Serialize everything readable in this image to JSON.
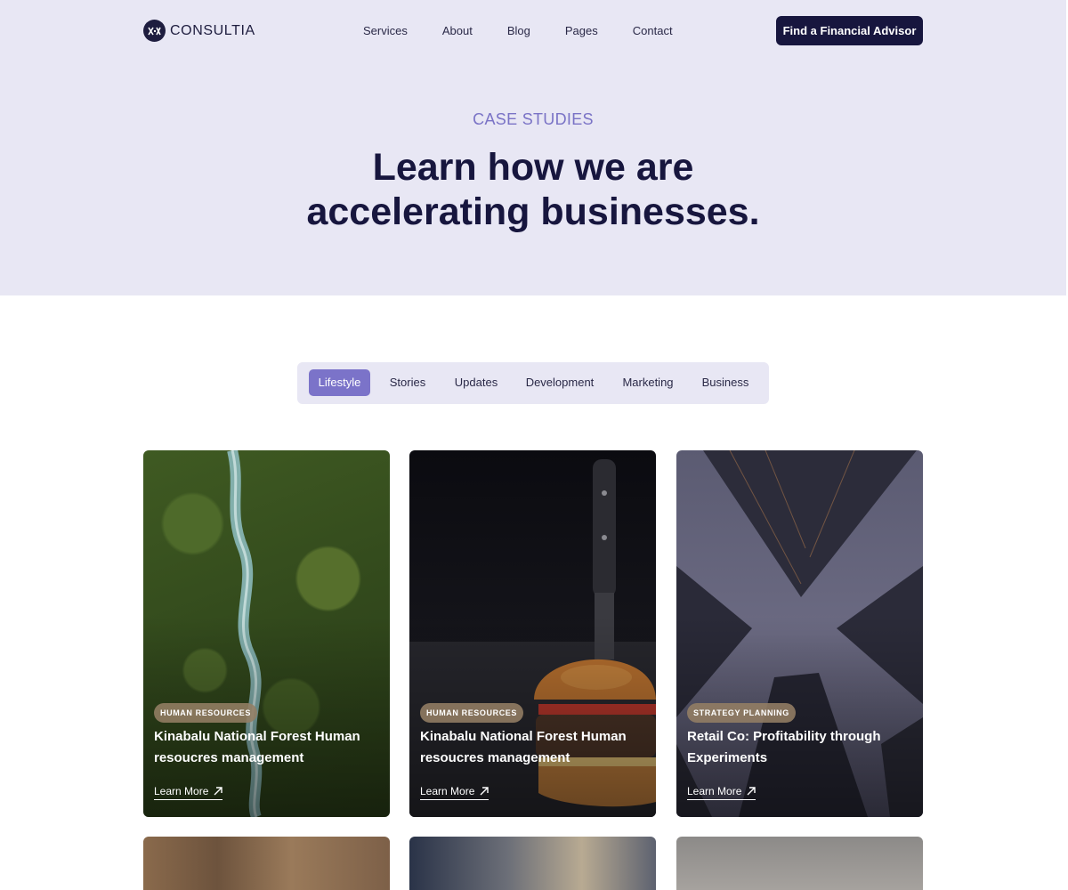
{
  "brand": {
    "name": "CONSULTIA"
  },
  "nav": {
    "items": [
      "Services",
      "About",
      "Blog",
      "Pages",
      "Contact"
    ],
    "cta_label": "Find a Financial Advisor"
  },
  "hero": {
    "eyebrow": "CASE STUDIES",
    "headline_line1": "Learn how we are",
    "headline_line2": "accelerating businesses."
  },
  "filters": {
    "items": [
      "Lifestyle",
      "Stories",
      "Updates",
      "Development",
      "Marketing",
      "Business"
    ],
    "active": "Lifestyle"
  },
  "cards": [
    {
      "tag": "HUMAN RESOURCES",
      "title": "Kinabalu National Forest Human resoucres management",
      "link": "Learn More",
      "image": "forest-river-aerial"
    },
    {
      "tag": "HUMAN RESOURCES",
      "title": "Kinabalu National Forest Human resoucres management",
      "link": "Learn More",
      "image": "burger-with-knife"
    },
    {
      "tag": "STRATEGY PLANNING",
      "title": "Retail Co: Profitability through Experiments",
      "link": "Learn More",
      "image": "skyscrapers-looking-up"
    }
  ],
  "colors": {
    "accent": "#7b73c9",
    "navy": "#17163e",
    "hero_bg": "#e8e7f4"
  }
}
